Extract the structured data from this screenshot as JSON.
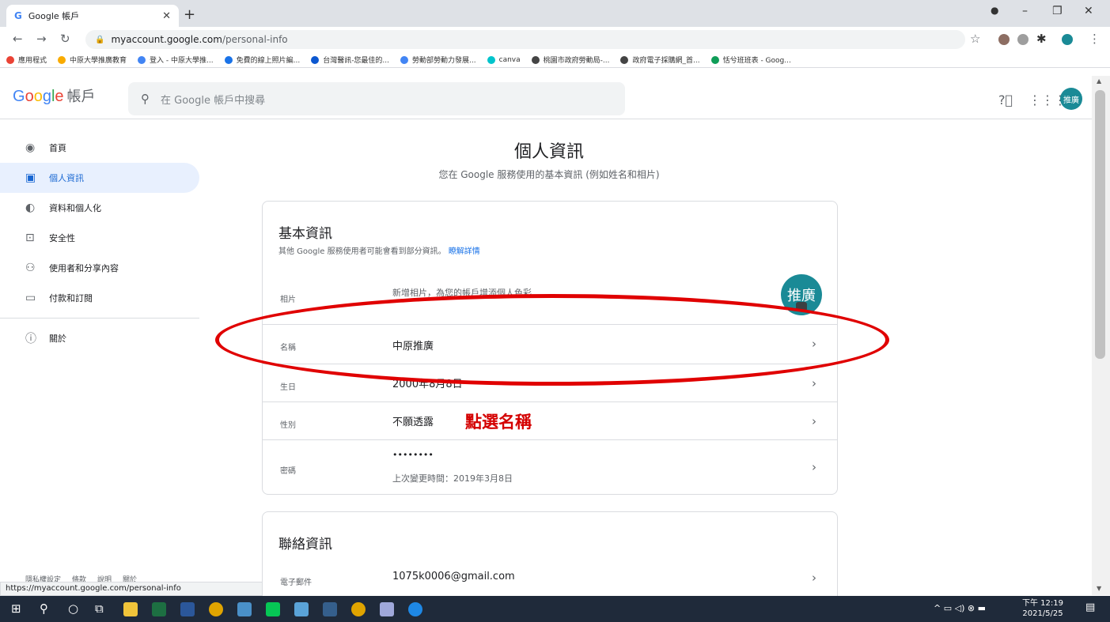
{
  "browser": {
    "tab_title": "Google 帳戶",
    "url_host": "myaccount.google.com",
    "url_path": "/personal-info",
    "bookmarks": [
      {
        "label": "應用程式",
        "color": "#ea4335"
      },
      {
        "label": "中原大學推廣教育",
        "color": "#f9ab00"
      },
      {
        "label": "登入 - 中原大學推...",
        "color": "#4285f4"
      },
      {
        "label": "免費的線上照片編...",
        "color": "#1a73e8"
      },
      {
        "label": "台灣醫訊-您最佳的...",
        "color": "#0b57d0"
      },
      {
        "label": "勞動部勞動力發展...",
        "color": "#4285f4"
      },
      {
        "label": "canva",
        "color": "#00c4cc"
      },
      {
        "label": "桃園市政府勞動局-...",
        "color": "#444444"
      },
      {
        "label": "政府電子採購網_首...",
        "color": "#444444"
      },
      {
        "label": "恬兮班班表 - Goog...",
        "color": "#0f9d58"
      }
    ],
    "status_url": "https://myaccount.google.com/personal-info"
  },
  "header": {
    "logo_brand": "Google",
    "logo_suffix": "帳戶",
    "search_placeholder": "在 Google 帳戶中搜尋",
    "avatar_text": "推廣"
  },
  "sidebar": {
    "items": [
      {
        "label": "首頁",
        "icon": "home-icon"
      },
      {
        "label": "個人資訊",
        "icon": "person-card-icon",
        "active": true
      },
      {
        "label": "資料和個人化",
        "icon": "toggle-icon"
      },
      {
        "label": "安全性",
        "icon": "lock-icon"
      },
      {
        "label": "使用者和分享內容",
        "icon": "people-icon"
      },
      {
        "label": "付款和訂閱",
        "icon": "card-icon"
      }
    ],
    "about_label": "關於",
    "footer": [
      "隱私權設定",
      "條款",
      "說明",
      "關於"
    ]
  },
  "main": {
    "title": "個人資訊",
    "subtitle": "您在 Google 服務使用的基本資訊 (例如姓名和相片)",
    "basic": {
      "heading": "基本資訊",
      "desc": "其他 Google 服務使用者可能會看到部分資訊。",
      "learn_more": "瞭解詳情",
      "photo_label": "相片",
      "photo_value": "新增相片，為您的帳戶增添個人色彩",
      "name_label": "名稱",
      "name_value": "中原推廣",
      "birthday_label": "生日",
      "birthday_value": "2000年8月8日",
      "gender_label": "性別",
      "gender_value": "不願透露",
      "password_label": "密碼",
      "password_value": "••••••••",
      "password_changed": "上次變更時間：2019年3月8日"
    },
    "contact": {
      "heading": "聯絡資訊",
      "email_label": "電子郵件",
      "email_value": "1075k0006@gmail.com"
    },
    "annotation": "點選名稱"
  },
  "taskbar": {
    "time": "下午 12:19",
    "date": "2021/5/25"
  },
  "colors": {
    "accent": "#1a73e8",
    "annotation_red": "#d40000",
    "avatar": "#1a8a96"
  }
}
